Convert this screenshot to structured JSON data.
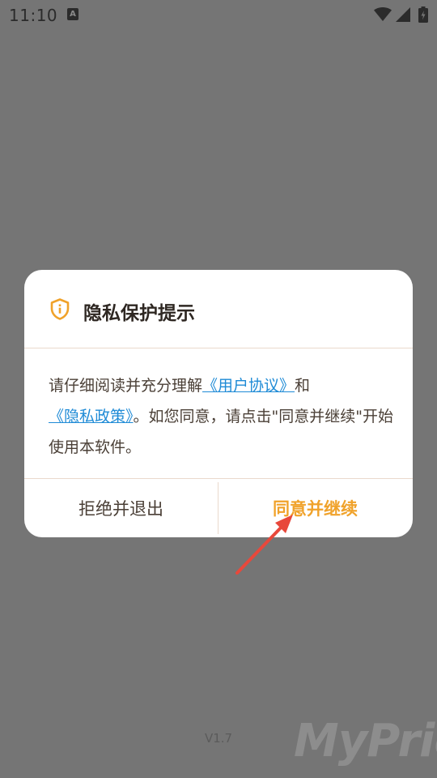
{
  "status_bar": {
    "time": "11:10",
    "notification_glyph": "A"
  },
  "dialog": {
    "title": "隐私保护提示",
    "body": {
      "intro": "请仔细阅读并充分理解",
      "user_agreement_link": "《用户协议》",
      "and": "和",
      "privacy_policy_link": "《隐私政策》",
      "rest": "。如您同意，请点击\"同意并继续\"开始使用本软件。"
    },
    "reject_label": "拒绝并退出",
    "agree_label": "同意并继续"
  },
  "footer": {
    "version": "V1.7",
    "watermark": "MyPrice"
  },
  "colors": {
    "overlay": "#757575",
    "accent": "#f0a22a",
    "link": "#1f8bd6",
    "arrow": "#e8483b"
  },
  "icons": [
    "a-icon",
    "wifi-icon",
    "signal-icon",
    "battery-icon",
    "shield-icon",
    "arrow-annotation"
  ]
}
